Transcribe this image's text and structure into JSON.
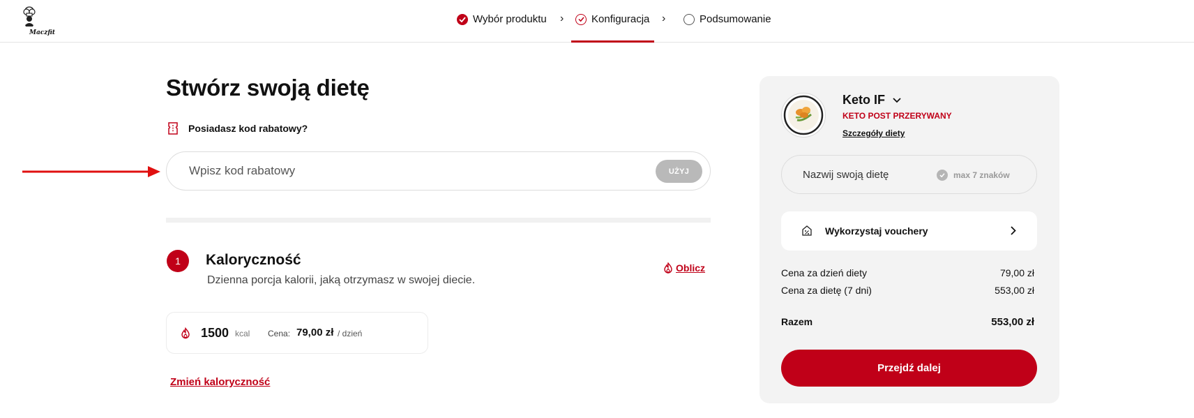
{
  "header": {
    "logo_text": "Maczfit",
    "steps": [
      {
        "label": "Wybór produktu",
        "state": "done"
      },
      {
        "label": "Konfiguracja",
        "state": "active"
      },
      {
        "label": "Podsumowanie",
        "state": "todo"
      }
    ],
    "separator": "›"
  },
  "main": {
    "title": "Stwórz swoją dietę",
    "promo_question": "Posiadasz kod rabatowy?",
    "promo_placeholder": "Wpisz kod rabatowy",
    "promo_button": "UŻYJ",
    "section": {
      "number": "1",
      "title": "Kaloryczność",
      "subtitle": "Dzienna porcja kalorii, jaką otrzymasz w swojej diecie.",
      "calc_link": "Oblicz"
    },
    "kcal_card": {
      "kcal_value": "1500",
      "kcal_unit": "kcal",
      "price_label": "Cena:",
      "price_value": "79,00 zł",
      "price_per": "/ dzień"
    },
    "change_link": "Zmień kaloryczność"
  },
  "panel": {
    "diet_name": "Keto IF",
    "diet_subtitle": "KETO POST PRZERYWANY",
    "diet_details_link": "Szczegóły diety",
    "name_placeholder": "Nazwij swoją dietę",
    "name_hint": "max 7 znaków",
    "voucher_label": "Wykorzystaj vouchery",
    "price_rows": [
      {
        "label": "Cena za dzień diety",
        "value": "79,00 zł"
      },
      {
        "label": "Cena za dietę (7 dni)",
        "value": "553,00 zł"
      }
    ],
    "total": {
      "label": "Razem",
      "value": "553,00 zł"
    },
    "next_button": "Przejdź dalej"
  },
  "colors": {
    "accent": "#c00018",
    "panel_bg": "#f3f3f3",
    "disabled_button": "#b9b9b9"
  },
  "icons": [
    "logo-chef-icon",
    "check-circle-icon",
    "ticket-icon",
    "flame-icon",
    "chevron-down-icon",
    "voucher-icon",
    "chevron-right-icon",
    "arrow-annotation"
  ]
}
